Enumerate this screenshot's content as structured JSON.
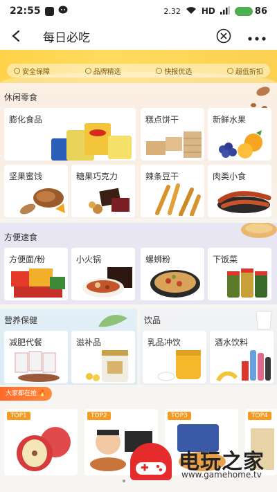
{
  "status_bar": {
    "time": "22:55",
    "network_speed": "2.32",
    "hd_label": "HD",
    "battery": "86"
  },
  "nav": {
    "title": "每日必吃"
  },
  "banner": {
    "badges": [
      "安全保障",
      "品牌精选",
      "快报优选",
      "超低折扣"
    ]
  },
  "sections": {
    "snacks": {
      "title": "休闲零食",
      "items": [
        "膨化食品",
        "糕点饼干",
        "新鲜水果",
        "坚果蜜饯",
        "糖果巧克力",
        "辣条豆干",
        "肉类小食"
      ]
    },
    "instant": {
      "title": "方便速食",
      "items": [
        "方便面/粉",
        "小火锅",
        "螺蛳粉",
        "下饭菜"
      ]
    },
    "health": {
      "title": "营养保健",
      "items": [
        "减肥代餐",
        "滋补品"
      ]
    },
    "drinks": {
      "title": "饮品",
      "items": [
        "乳品冲饮",
        "酒水饮料"
      ]
    }
  },
  "hot": {
    "tag": "大家都在抢",
    "tops": [
      "TOP1",
      "TOP2",
      "TOP3",
      "TOP4"
    ]
  },
  "watermark": {
    "name": "电玩之家",
    "url": "www.gamehome.tv"
  },
  "colors": {
    "accent_orange": "#ff6a2a",
    "banner_yellow": "#ffd24a",
    "battery_green": "#4caf50"
  }
}
